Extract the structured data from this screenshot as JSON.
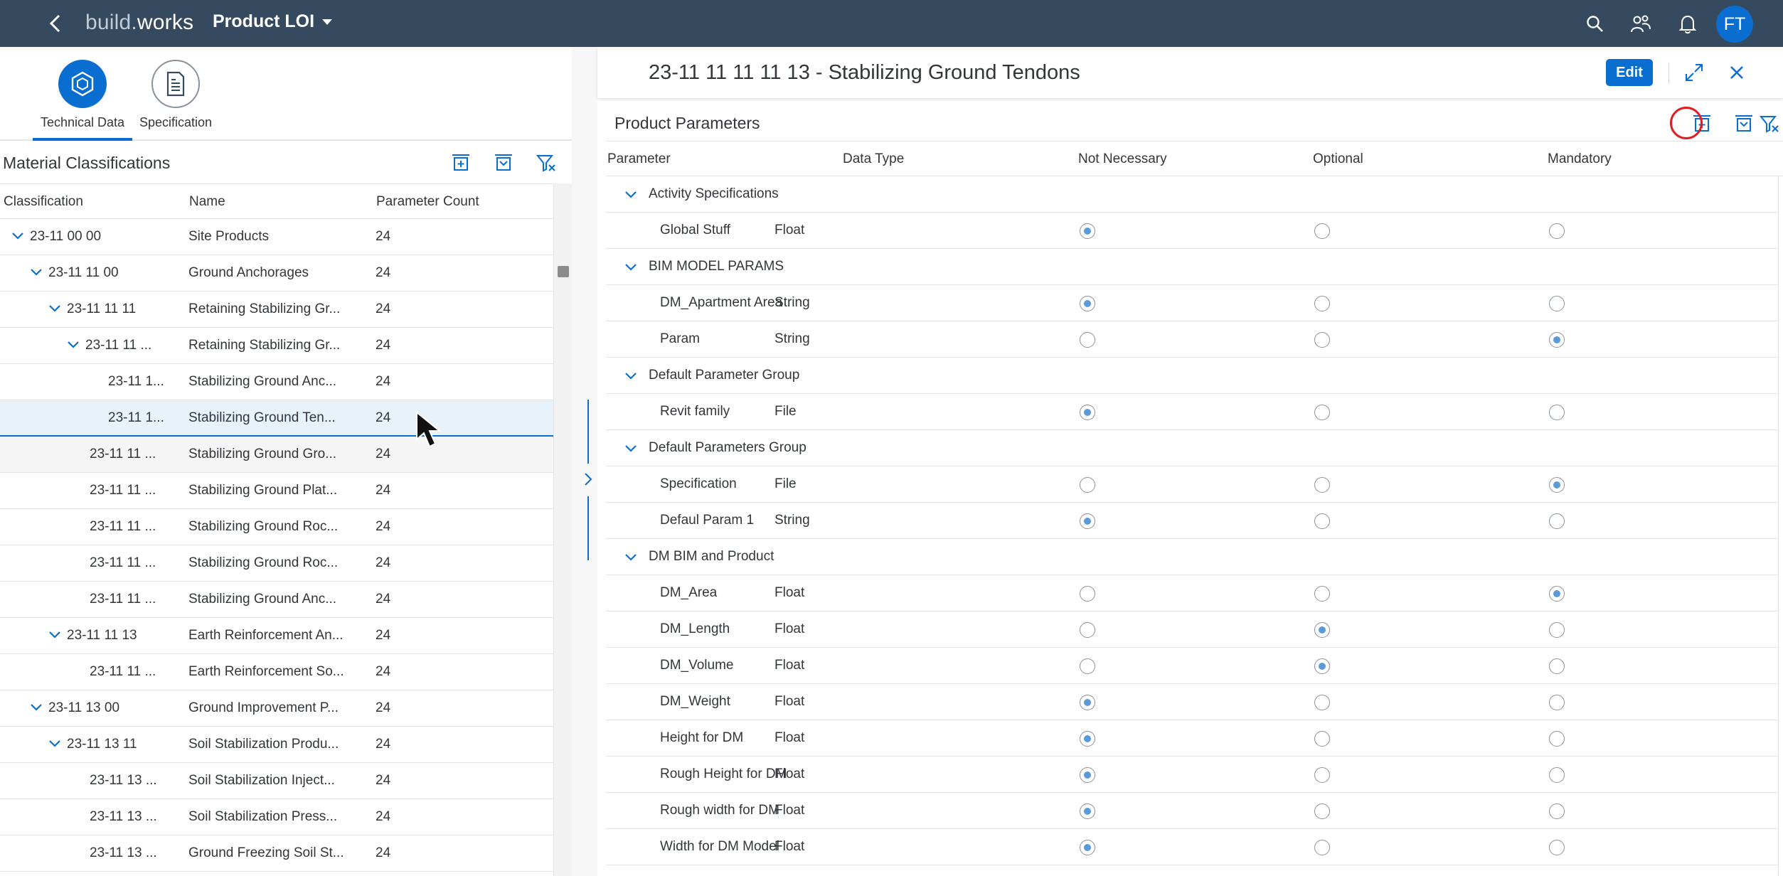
{
  "shell": {
    "brand_part1": "build.",
    "brand_part2": "works",
    "product_menu": "Product LOI",
    "avatar_initials": "FT",
    "icons": [
      "back-icon",
      "search-icon",
      "people-icon",
      "bell-icon"
    ]
  },
  "left_tabs": [
    {
      "label": "Technical Data",
      "icon": "cube-icon",
      "active": true
    },
    {
      "label": "Specification",
      "icon": "document-icon",
      "active": false
    }
  ],
  "material_classifications": {
    "title": "Material Classifications",
    "columns": [
      "Classification",
      "Name",
      "Parameter Count"
    ],
    "rows": [
      {
        "cls": "23-11 00 00",
        "name": "Site Products",
        "count": "24",
        "level": 0,
        "expandable": true
      },
      {
        "cls": "23-11 11 00",
        "name": "Ground Anchorages",
        "count": "24",
        "level": 1,
        "expandable": true
      },
      {
        "cls": "23-11 11 11",
        "name": "Retaining Stabilizing Gr...",
        "count": "24",
        "level": 2,
        "expandable": true
      },
      {
        "cls": "23-11 11 ...",
        "name": "Retaining Stabilizing Gr...",
        "count": "24",
        "level": 3,
        "expandable": true
      },
      {
        "cls": "23-11 1...",
        "name": "Stabilizing Ground Anc...",
        "count": "24",
        "level": 4,
        "expandable": false
      },
      {
        "cls": "23-11 1...",
        "name": "Stabilizing Ground Ten...",
        "count": "24",
        "level": 4,
        "expandable": false,
        "selected": true
      },
      {
        "cls": "23-11 11 ...",
        "name": "Stabilizing Ground Gro...",
        "count": "24",
        "level": 3,
        "expandable": false,
        "hovered": true
      },
      {
        "cls": "23-11 11 ...",
        "name": "Stabilizing Ground Plat...",
        "count": "24",
        "level": 3,
        "expandable": false
      },
      {
        "cls": "23-11 11 ...",
        "name": "Stabilizing Ground Roc...",
        "count": "24",
        "level": 3,
        "expandable": false
      },
      {
        "cls": "23-11 11 ...",
        "name": "Stabilizing Ground Roc...",
        "count": "24",
        "level": 3,
        "expandable": false
      },
      {
        "cls": "23-11 11 ...",
        "name": "Stabilizing Ground Anc...",
        "count": "24",
        "level": 3,
        "expandable": false
      },
      {
        "cls": "23-11 11 13",
        "name": "Earth Reinforcement An...",
        "count": "24",
        "level": 2,
        "expandable": true
      },
      {
        "cls": "23-11 11 ...",
        "name": "Earth Reinforcement So...",
        "count": "24",
        "level": 3,
        "expandable": false
      },
      {
        "cls": "23-11 13 00",
        "name": "Ground Improvement P...",
        "count": "24",
        "level": 1,
        "expandable": true
      },
      {
        "cls": "23-11 13 11",
        "name": "Soil Stabilization Produ...",
        "count": "24",
        "level": 2,
        "expandable": true
      },
      {
        "cls": "23-11 13 ...",
        "name": "Soil Stabilization Inject...",
        "count": "24",
        "level": 3,
        "expandable": false
      },
      {
        "cls": "23-11 13 ...",
        "name": "Soil Stabilization Press...",
        "count": "24",
        "level": 3,
        "expandable": false
      },
      {
        "cls": "23-11 13 ...",
        "name": "Ground Freezing Soil St...",
        "count": "24",
        "level": 3,
        "expandable": false
      }
    ]
  },
  "detail": {
    "title": "23-11 11 11 11 13 - Stabilizing Ground Tendons",
    "edit_label": "Edit",
    "section_title": "Product Parameters",
    "columns": [
      "Parameter",
      "Data Type",
      "Not Necessary",
      "Optional",
      "Mandatory"
    ],
    "rows": [
      {
        "group": "Activity Specifications"
      },
      {
        "param": "Global Stuff",
        "type": "Float",
        "choice": 0
      },
      {
        "group": "BIM MODEL PARAMS"
      },
      {
        "param": "DM_Apartment Area",
        "type": "String",
        "choice": 0
      },
      {
        "param": "Param",
        "type": "String",
        "choice": 2
      },
      {
        "group": "Default Parameter Group"
      },
      {
        "param": "Revit family",
        "type": "File",
        "choice": 0
      },
      {
        "group": "Default Parameters Group"
      },
      {
        "param": "Specification",
        "type": "File",
        "choice": 2
      },
      {
        "param": "Defaul Param 1",
        "type": "String",
        "choice": 0
      },
      {
        "group": "DM BIM and Product"
      },
      {
        "param": "DM_Area",
        "type": "Float",
        "choice": 2
      },
      {
        "param": "DM_Length",
        "type": "Float",
        "choice": 1
      },
      {
        "param": "DM_Volume",
        "type": "Float",
        "choice": 1
      },
      {
        "param": "DM_Weight",
        "type": "Float",
        "choice": 0
      },
      {
        "param": "Height for DM",
        "type": "Float",
        "choice": 0
      },
      {
        "param": "Rough Height for DM",
        "type": "Float",
        "choice": 0
      },
      {
        "param": "Rough width for DM",
        "type": "Float",
        "choice": 0
      },
      {
        "param": "Width for DM Model",
        "type": "Float",
        "choice": 0
      }
    ]
  },
  "colors": {
    "shell": "#354a5f",
    "accent": "#0a6ed1",
    "highlight": "#e11d21",
    "selected_row": "#e8f2fb"
  }
}
